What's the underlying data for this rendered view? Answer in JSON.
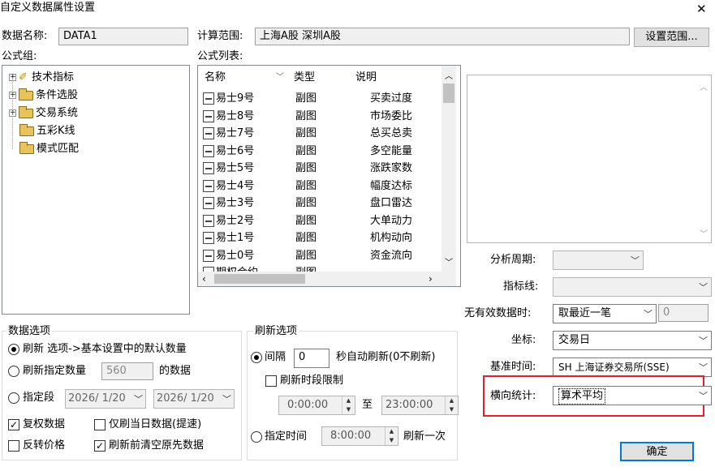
{
  "window": {
    "title": "自定义数据属性设置",
    "close_glyph": "✕"
  },
  "name_label": "数据名称:",
  "name_value": "DATA1",
  "calc_range_label": "计算范围:",
  "calc_range_value": "上海A股   深圳A股",
  "set_range_button": "设置范围...",
  "formula_group_label": "公式组:",
  "formula_list_label": "公式列表:",
  "tree": [
    "技术指标",
    "条件选股",
    "交易系统",
    "五彩K线",
    "模式匹配"
  ],
  "list_headers": {
    "name": "名称",
    "type": "类型",
    "desc": "说明"
  },
  "list_rows": [
    {
      "name": "易士9号",
      "type": "副图",
      "desc": "买卖过度"
    },
    {
      "name": "易士8号",
      "type": "副图",
      "desc": "市场委比"
    },
    {
      "name": "易士7号",
      "type": "副图",
      "desc": "总买总卖"
    },
    {
      "name": "易士6号",
      "type": "副图",
      "desc": "多空能量"
    },
    {
      "name": "易士5号",
      "type": "副图",
      "desc": "涨跌家数"
    },
    {
      "name": "易士4号",
      "type": "副图",
      "desc": "幅度达标"
    },
    {
      "name": "易士3号",
      "type": "副图",
      "desc": "盘口雷达"
    },
    {
      "name": "易士2号",
      "type": "副图",
      "desc": "大单动力"
    },
    {
      "name": "易士1号",
      "type": "副图",
      "desc": "机构动向"
    },
    {
      "name": "易士0号",
      "type": "副图",
      "desc": "资金流向"
    },
    {
      "name": "期权合约",
      "type": "副图",
      "desc": ""
    }
  ],
  "right": {
    "period_label": "分析周期:",
    "index_line_label": "指标线:",
    "invalid_label": "无有效数据时:",
    "invalid_value": "取最近一笔",
    "invalid_num": "0",
    "coord_label": "坐标:",
    "coord_value": "交易日",
    "base_time_label": "基准时间:",
    "base_time_value": "SH 上海证券交易所(SSE)",
    "horiz_label": "横向统计:",
    "horiz_value": "算术平均",
    "ok_button": "确定",
    "highlight_color": "#e0202a"
  },
  "data_options": {
    "title": "数据选项",
    "opt1": "刷新 选项->基本设置中的默认数量",
    "opt2": "刷新指定数量",
    "opt2_value": "560",
    "opt2_suffix": "的数据",
    "opt3": "指定段",
    "date1": "2026/ 1/20",
    "date2": "2026/ 1/20",
    "chk1": "复权数据",
    "chk2": "仅刷当日数据(提速)",
    "chk3": "反转价格",
    "chk4": "刷新前清空原先数据"
  },
  "refresh_options": {
    "title": "刷新选项",
    "interval": "间隔",
    "interval_value": "0",
    "interval_suffix": "秒自动刷新(0不刷新)",
    "period_limit": "刷新时段限制",
    "time_from": "0:00:00",
    "to": "至",
    "time_to": "23:00:00",
    "at_time": "指定时间",
    "at_time_value": "8:00:00",
    "once": "刷新一次"
  }
}
